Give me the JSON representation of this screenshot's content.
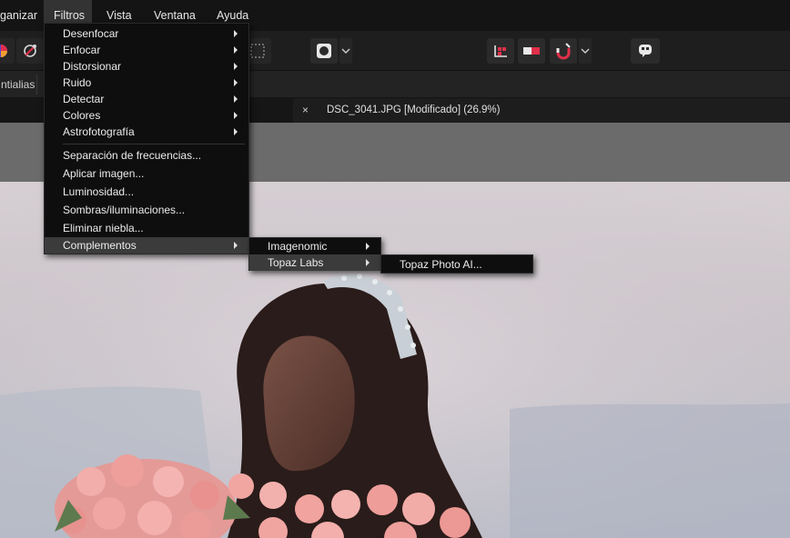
{
  "menubar": {
    "items": [
      "ganizar",
      "Filtros",
      "Vista",
      "Ventana",
      "Ayuda"
    ]
  },
  "subbar": {
    "tab_label": "ntialias"
  },
  "document": {
    "close_symbol": "×",
    "title": "DSC_3041.JPG [Modificado] (26.9%)"
  },
  "toolbar": {
    "icons": [
      "color-wheel-icon",
      "eyedropper-icon",
      "marquee-selection-icon",
      "record-circle-icon",
      "dropdown-chevron-icon",
      "grid-snap-icon",
      "toggle-icon",
      "magnet-snap-icon",
      "dropdown-chevron-icon",
      "assistant-icon"
    ],
    "accent": "#e0304a"
  },
  "filters_menu": {
    "items": [
      {
        "label": "Desenfocar",
        "submenu": true
      },
      {
        "label": "Enfocar",
        "submenu": true
      },
      {
        "label": "Distorsionar",
        "submenu": true
      },
      {
        "label": "Ruido",
        "submenu": true
      },
      {
        "label": "Detectar",
        "submenu": true
      },
      {
        "label": "Colores",
        "submenu": true
      },
      {
        "label": "Astrofotografía",
        "submenu": true
      },
      {
        "label": "Separación de frecuencias...",
        "submenu": false
      },
      {
        "label": "Aplicar imagen...",
        "submenu": false
      },
      {
        "label": "Luminosidad...",
        "submenu": false
      },
      {
        "label": "Sombras/iluminaciones...",
        "submenu": false
      },
      {
        "label": "Eliminar niebla...",
        "submenu": false
      },
      {
        "label": "Complementos",
        "submenu": true,
        "highlighted": true
      }
    ]
  },
  "plugins_menu": {
    "items": [
      {
        "label": "Imagenomic",
        "submenu": true
      },
      {
        "label": "Topaz Labs",
        "submenu": true,
        "highlighted": true
      }
    ]
  },
  "topaz_menu": {
    "items": [
      {
        "label": "Topaz Photo AI..."
      }
    ]
  }
}
